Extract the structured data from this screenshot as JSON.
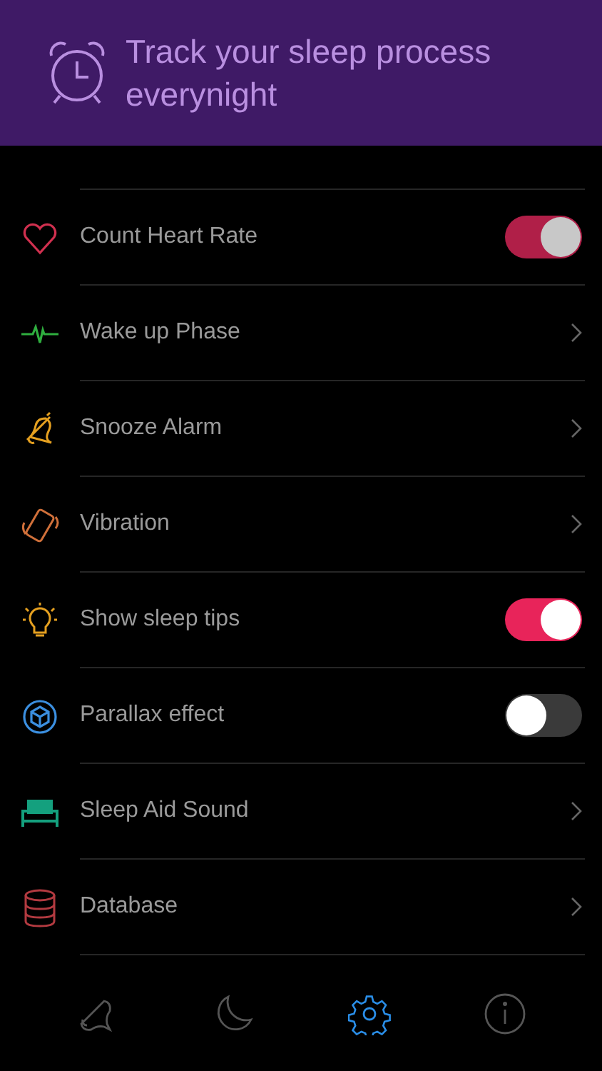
{
  "banner": {
    "text": "Track your sleep process everynight"
  },
  "settings": [
    {
      "kind": "toggle",
      "label": "Count Heart Rate",
      "on": true,
      "disabled": true
    },
    {
      "kind": "link",
      "label": "Wake up Phase"
    },
    {
      "kind": "link",
      "label": "Snooze Alarm"
    },
    {
      "kind": "link",
      "label": "Vibration"
    },
    {
      "kind": "toggle",
      "label": "Show sleep tips",
      "on": true,
      "disabled": false
    },
    {
      "kind": "toggle",
      "label": "Parallax effect",
      "on": false,
      "disabled": false
    },
    {
      "kind": "link",
      "label": "Sleep Aid Sound"
    },
    {
      "kind": "link",
      "label": "Database"
    }
  ],
  "tabs": [
    {
      "selected": false
    },
    {
      "selected": false
    },
    {
      "selected": true
    },
    {
      "selected": false
    }
  ]
}
